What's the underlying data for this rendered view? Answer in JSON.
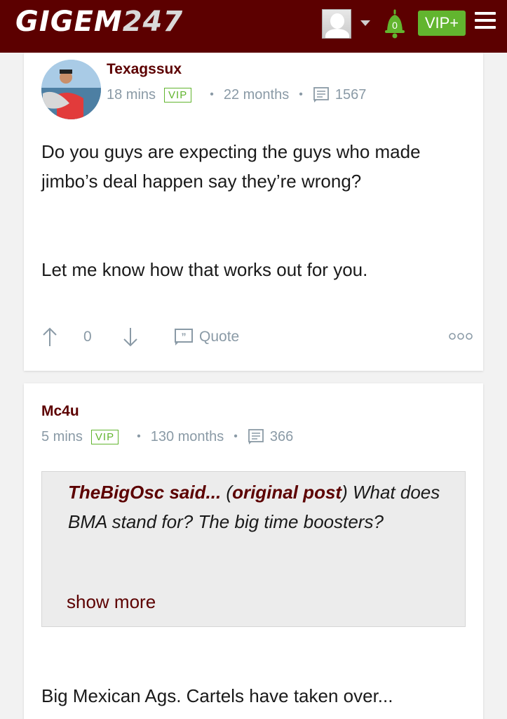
{
  "header": {
    "logo_main": "GIGEM",
    "logo_num": "247",
    "notifications_count": "0",
    "vip_label": "VIP+"
  },
  "posts": [
    {
      "username": "Texagssux",
      "time": "18 mins",
      "badge": "VIP",
      "tenure": "22 months",
      "post_count": "1567",
      "paragraphs": [
        "Do you guys are expecting the guys who made jimbo’s deal happen say they’re wrong?",
        "Let me know how that works out for you."
      ],
      "votes": "0",
      "quote_label": "Quote"
    },
    {
      "username": "Mc4u",
      "time": "5 mins",
      "badge": "VIP",
      "tenure": "130 months",
      "post_count": "366",
      "quote": {
        "author": "TheBigOsc said...",
        "link_label": "original post",
        "open_paren": " (",
        "close_paren": ")",
        "text": " What does BMA stand for? The big time boosters?",
        "show_more": "show more"
      },
      "paragraphs": [
        "Big Mexican Ags. Cartels have taken over..."
      ]
    }
  ],
  "colors": {
    "brand": "#5c0000",
    "vip_green": "#62b52f",
    "meta_gray": "#8a9aa6"
  },
  "icons": [
    "user-avatar-icon",
    "caret-down-icon",
    "bell-icon",
    "hamburger-menu-icon",
    "message-icon",
    "arrow-up-icon",
    "arrow-down-icon",
    "quote-icon",
    "more-options-icon"
  ]
}
